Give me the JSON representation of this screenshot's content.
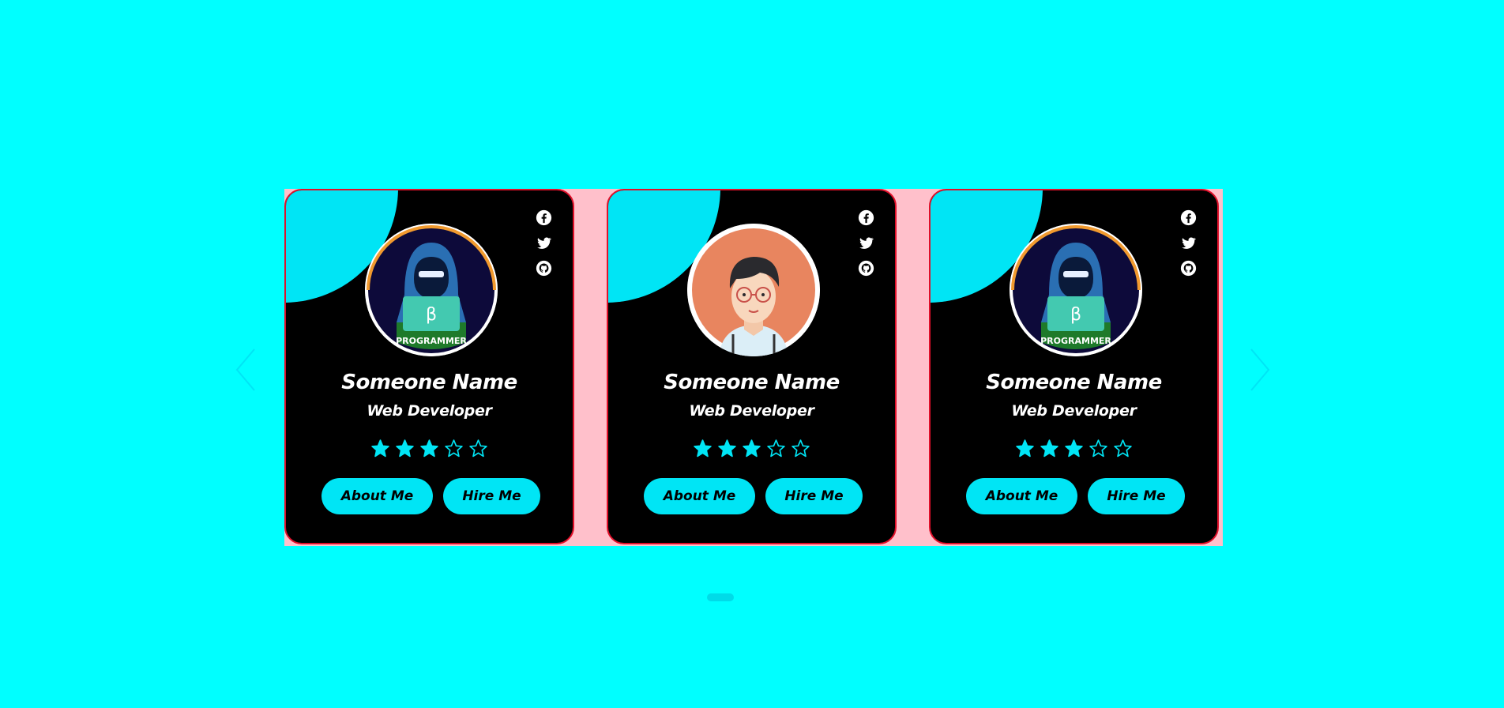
{
  "colors": {
    "page_background": "#00ffff",
    "track_background": "#ffc0cb",
    "card_background": "#000000",
    "card_border": "#e0102a",
    "accent": "#00e5f5"
  },
  "cards": [
    {
      "avatar": "programmer-avatar",
      "avatar_badge": "PROGRAMMER",
      "avatar_symbol": "β",
      "name": "Someone Name",
      "role": "Web Developer",
      "rating": 3,
      "rating_max": 5,
      "about_label": "About Me",
      "hire_label": "Hire Me",
      "social": [
        "facebook-icon",
        "twitter-icon",
        "github-icon"
      ]
    },
    {
      "avatar": "man-with-glasses-avatar",
      "name": "Someone Name",
      "role": "Web Developer",
      "rating": 3,
      "rating_max": 5,
      "about_label": "About Me",
      "hire_label": "Hire Me",
      "social": [
        "facebook-icon",
        "twitter-icon",
        "github-icon"
      ]
    },
    {
      "avatar": "programmer-avatar",
      "avatar_badge": "PROGRAMMER",
      "avatar_symbol": "β",
      "name": "Someone Name",
      "role": "Web Developer",
      "rating": 3,
      "rating_max": 5,
      "about_label": "About Me",
      "hire_label": "Hire Me",
      "social": [
        "facebook-icon",
        "twitter-icon",
        "github-icon"
      ]
    }
  ],
  "navigation": {
    "prev_icon": "chevron-left-icon",
    "next_icon": "chevron-right-icon",
    "pagination": {
      "pages": 1,
      "active": 1
    }
  }
}
